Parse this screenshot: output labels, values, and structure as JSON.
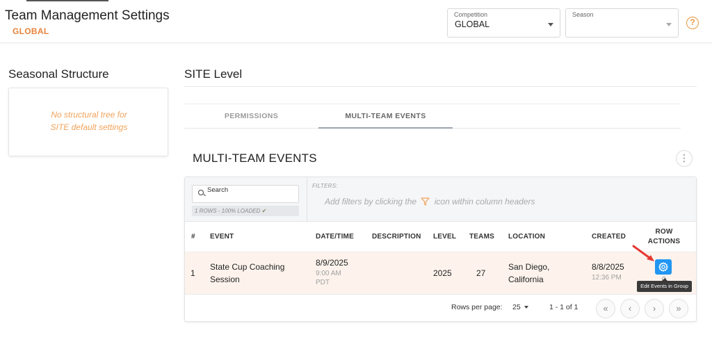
{
  "header": {
    "title": "Team Management Settings",
    "subtitle": "GLOBAL",
    "competition": {
      "label": "Competition",
      "value": "GLOBAL"
    },
    "season": {
      "label": "Season",
      "value": ""
    },
    "help_glyph": "?"
  },
  "left": {
    "title": "Seasonal Structure",
    "empty_line1": "No structural tree for",
    "empty_line2": "SITE default settings"
  },
  "main": {
    "title": "SITE Level",
    "tabs": [
      {
        "label": "PERMISSIONS",
        "active": false
      },
      {
        "label": "MULTI-TEAM EVENTS",
        "active": true
      }
    ],
    "section_title": "MULTI-TEAM EVENTS",
    "kebab_glyph": "⋮"
  },
  "grid": {
    "search_label": "Search",
    "rows_status": "1 ROWS - 100% LOADED",
    "filters_label": "FILTERS:",
    "filters_hint_pre": "Add filters by clicking the",
    "filters_hint_post": "icon within column headers",
    "columns": {
      "index": "#",
      "event": "EVENT",
      "datetime": "DATE/TIME",
      "description": "DESCRIPTION",
      "level": "LEVEL",
      "teams": "TEAMS",
      "location": "LOCATION",
      "created": "CREATED",
      "row_actions_1": "ROW",
      "row_actions_2": "ACTIONS"
    },
    "rows": [
      {
        "index": "1",
        "event_line1": "State Cup Coaching",
        "event_line2": "Session",
        "date": "8/9/2025",
        "time": "9:00 AM",
        "tz": "PDT",
        "description": "",
        "level": "2025",
        "teams": "27",
        "location_line1": "San Diego,",
        "location_line2": "California",
        "created_date": "8/8/2025",
        "created_time": "12:36 PM",
        "action_tooltip": "Edit Events in Group"
      }
    ],
    "footer": {
      "rows_per_page_label": "Rows per page:",
      "rows_per_page_value": "25",
      "range": "1 - 1 of 1",
      "first_glyph": "«",
      "prev_glyph": "‹",
      "next_glyph": "›",
      "last_glyph": "»"
    }
  },
  "colors": {
    "accent_orange": "#e8823a",
    "action_blue": "#2196f3",
    "row_highlight": "#fdf3ec",
    "annotation_red": "#e53935"
  }
}
